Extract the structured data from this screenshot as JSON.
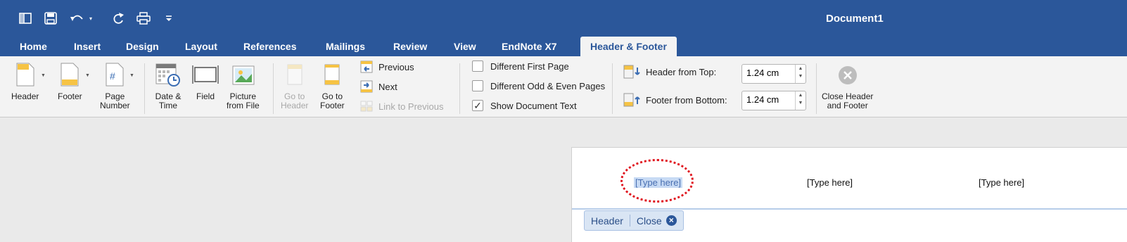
{
  "window": {
    "title": "Document1"
  },
  "qat": [
    {
      "icon": "sidebar-icon"
    },
    {
      "icon": "save-icon"
    },
    {
      "icon": "undo-icon"
    },
    {
      "icon": "redo-icon"
    },
    {
      "icon": "print-icon"
    },
    {
      "icon": "customize-icon"
    }
  ],
  "tabs": [
    "Home",
    "Insert",
    "Design",
    "Layout",
    "References",
    "Mailings",
    "Review",
    "View",
    "EndNote X7",
    "Header & Footer"
  ],
  "ribbon": {
    "header": {
      "label": "Header"
    },
    "footer": {
      "label": "Footer"
    },
    "page_number": {
      "line1": "Page",
      "line2": "Number"
    },
    "date_time": {
      "line1": "Date &",
      "line2": "Time"
    },
    "field": {
      "label": "Field"
    },
    "picture": {
      "line1": "Picture",
      "line2": "from File"
    },
    "goto_header": {
      "line1": "Go to",
      "line2": "Header"
    },
    "goto_footer": {
      "line1": "Go to",
      "line2": "Footer"
    },
    "previous": "Previous",
    "next": "Next",
    "link_previous": "Link to Previous",
    "options": [
      {
        "label": "Different First Page",
        "checked": false
      },
      {
        "label": "Different Odd & Even Pages",
        "checked": false
      },
      {
        "label": "Show Document Text",
        "checked": true
      }
    ],
    "header_from_top": {
      "label": "Header from Top:",
      "value": "1.24 cm"
    },
    "footer_from_bottom": {
      "label": "Footer from Bottom:",
      "value": "1.24 cm"
    },
    "close": {
      "line1": "Close Header",
      "line2": "and Footer"
    }
  },
  "document": {
    "placeholders": [
      "[Type here]",
      "[Type here]",
      "[Type here]"
    ],
    "tag": {
      "header": "Header",
      "close": "Close"
    }
  },
  "colors": {
    "accent": "#2b579a",
    "annotation": "#e0141e",
    "selection": "#c7daf4"
  }
}
